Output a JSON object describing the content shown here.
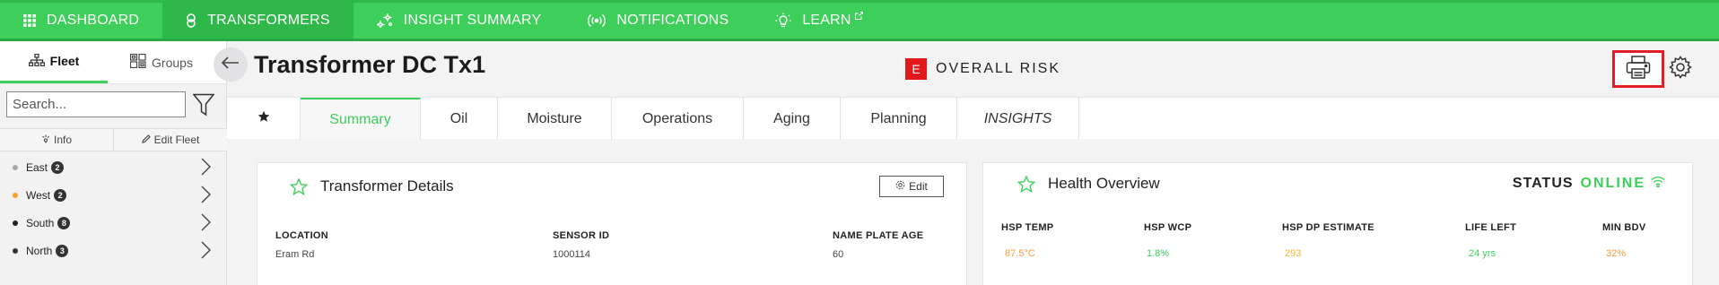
{
  "topnav": {
    "items": [
      {
        "label": "DASHBOARD",
        "icon": "grid-icon",
        "active": false
      },
      {
        "label": "TRANSFORMERS",
        "icon": "transformer-icon",
        "active": true
      },
      {
        "label": "INSIGHT SUMMARY",
        "icon": "sparkle-icon",
        "active": false
      },
      {
        "label": "NOTIFICATIONS",
        "icon": "broadcast-icon",
        "active": false
      },
      {
        "label": "LEARN",
        "icon": "lightbulb-icon",
        "active": false
      }
    ]
  },
  "sidebar": {
    "tabs": [
      {
        "label": "Fleet",
        "icon": "hierarchy-icon",
        "active": true
      },
      {
        "label": "Groups",
        "icon": "groups-icon",
        "active": false
      }
    ],
    "search_placeholder": "Search...",
    "info_label": "Info",
    "edit_fleet_label": "Edit Fleet",
    "regions": [
      {
        "name": "East",
        "count": "2",
        "color": "#aaaaaa"
      },
      {
        "name": "West",
        "count": "2",
        "color": "#f5a623"
      },
      {
        "name": "South",
        "count": "8",
        "color": "#222222"
      },
      {
        "name": "North",
        "count": "3",
        "color": "#333333"
      }
    ]
  },
  "header": {
    "title": "Transformer DC Tx1",
    "risk_badge": "E",
    "risk_label": "OVERALL RISK",
    "risk_color": "#e2181b"
  },
  "tabs": [
    "Summary",
    "Oil",
    "Moisture",
    "Operations",
    "Aging",
    "Planning",
    "INSIGHTS"
  ],
  "transformer_details": {
    "title": "Transformer Details",
    "edit_label": "Edit",
    "fields": [
      {
        "label": "LOCATION",
        "value": "Eram Rd"
      },
      {
        "label": "SENSOR ID",
        "value": "1000114"
      },
      {
        "label": "NAME PLATE AGE",
        "value": "60"
      }
    ]
  },
  "health_overview": {
    "title": "Health Overview",
    "status_label": "STATUS",
    "status_value": "ONLINE",
    "metrics": [
      {
        "label": "HSP TEMP",
        "value": "87.5°C",
        "color": "#f39c3c"
      },
      {
        "label": "HSP WCP",
        "value": "1.8%",
        "color": "#3ecf5a"
      },
      {
        "label": "HSP DP ESTIMATE",
        "value": "293",
        "color": "#f5b82e"
      },
      {
        "label": "LIFE LEFT",
        "value": "24 yrs",
        "color": "#3ecf5a"
      },
      {
        "label": "MIN BDV",
        "value": "32%",
        "color": "#f39c3c"
      }
    ]
  },
  "colors": {
    "accent": "#3ecf5a",
    "alert": "#e21f26"
  }
}
